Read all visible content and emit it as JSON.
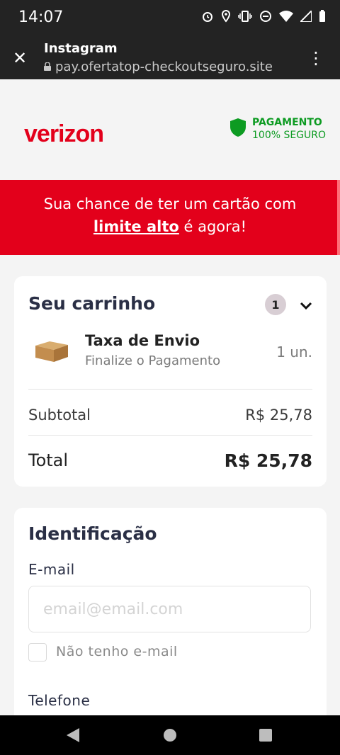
{
  "status_bar": {
    "time": "14:07"
  },
  "browser": {
    "title": "Instagram",
    "url": "pay.ofertatop-checkoutseguro.site"
  },
  "header": {
    "logo": "verizon",
    "secure_line1": "PAGAMENTO",
    "secure_line2": "100% SEGURO"
  },
  "banner": {
    "line1": "Sua chance de ter um cartão com",
    "highlight": "limite alto",
    "line2_rest": " é agora!"
  },
  "cart": {
    "title": "Seu carrinho",
    "count": "1",
    "product": {
      "name": "Taxa de Envio",
      "subtitle": "Finalize o Pagamento",
      "qty": "1 un."
    },
    "subtotal_label": "Subtotal",
    "subtotal_value": "R$ 25,78",
    "total_label": "Total",
    "total_value": "R$ 25,78"
  },
  "identification": {
    "title": "Identificação",
    "email_label": "E-mail",
    "email_placeholder": "email@email.com",
    "no_email_label": "Não tenho e-mail",
    "phone_label": "Telefone"
  },
  "colors": {
    "brand_red": "#e3001b",
    "secure_green": "#0d9b22",
    "dark_bar": "#232323"
  }
}
